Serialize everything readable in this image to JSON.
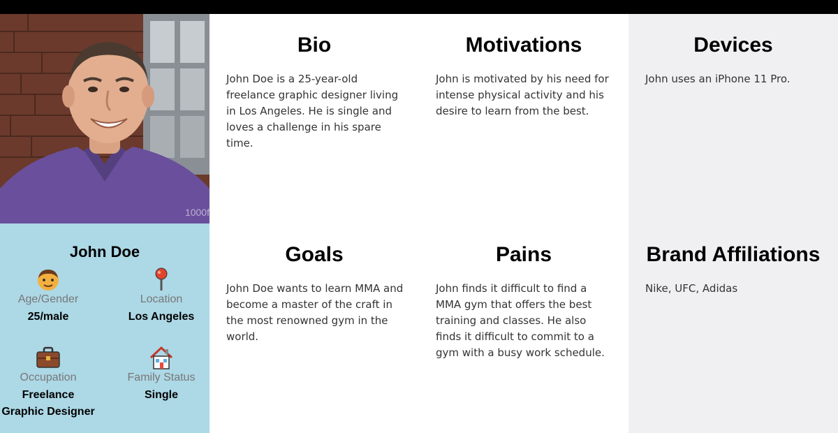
{
  "profile": {
    "name": "John Doe",
    "photo_watermark": "1000f",
    "attributes": [
      {
        "icon": "face-icon",
        "label": "Age/Gender",
        "value": "25/male"
      },
      {
        "icon": "location-pin-icon",
        "label": "Location",
        "value": "Los Angeles"
      },
      {
        "icon": "briefcase-icon",
        "label": "Occupation",
        "value": "Freelance Graphic Designer"
      },
      {
        "icon": "house-icon",
        "label": "Family Status",
        "value": "Single"
      }
    ]
  },
  "cards": {
    "bio": {
      "title": "Bio",
      "text": "John Doe is a 25-year-old freelance graphic designer living in Los Angeles. He is single and loves a challenge in his spare time."
    },
    "motivations": {
      "title": "Motivations",
      "text": "John is motivated by his need for intense physical activity and his desire to learn from the best."
    },
    "devices": {
      "title": "Devices",
      "text": "John uses an iPhone 11 Pro."
    },
    "goals": {
      "title": "Goals",
      "text": "John Doe wants to learn MMA and become a master of the craft in the most renowned gym in the world."
    },
    "pains": {
      "title": "Pains",
      "text": "John finds it difficult to find a MMA gym that offers the best training and classes. He also finds it difficult to commit to a gym with a busy work schedule."
    },
    "brand_affiliations": {
      "title": "Brand Affiliations",
      "text": "Nike, UFC, Adidas"
    }
  },
  "colors": {
    "profile_bg": "#add8e6",
    "side_column_bg": "#f0f0f2",
    "shirt": "#6a4f9c"
  }
}
